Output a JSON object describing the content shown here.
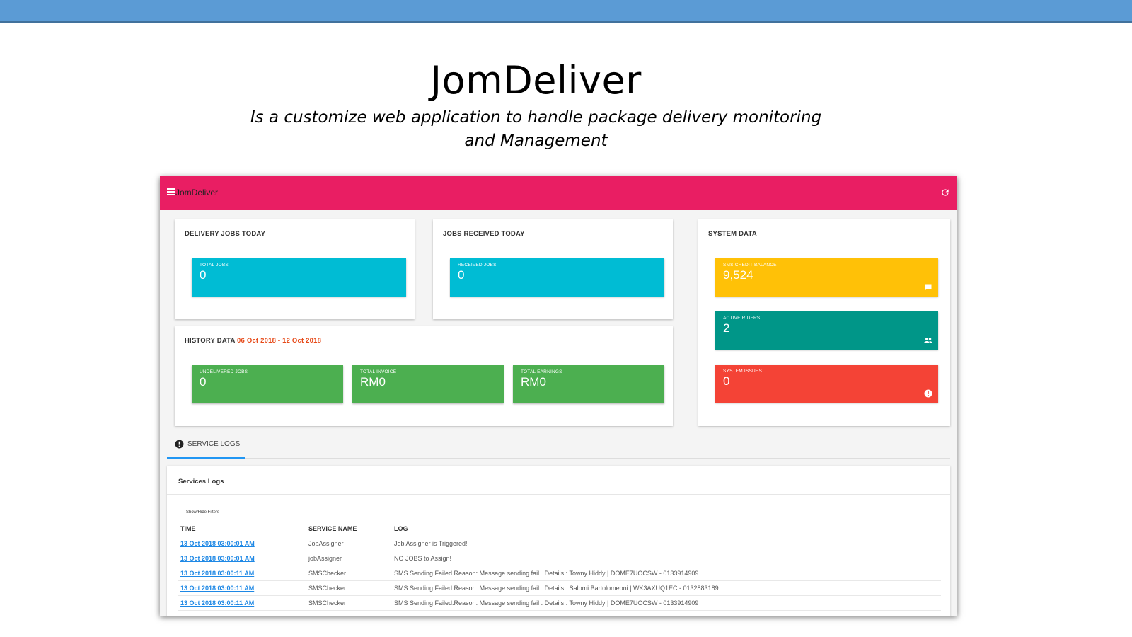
{
  "slide": {
    "title": "JomDeliver",
    "subtitle": "Is a customize web application to handle package delivery monitoring and Management"
  },
  "app": {
    "name": "JomDeliver",
    "icons": {
      "menu": "hamburger-menu-icon",
      "refresh": "refresh-icon"
    }
  },
  "delivery": {
    "heading": "DELIVERY JOBS TODAY",
    "tile_label": "TOTAL JOBS",
    "tile_value": "0"
  },
  "received": {
    "heading": "JOBS RECEIVED TODAY",
    "tile_label": "RECEIVED JOBS",
    "tile_value": "0"
  },
  "history": {
    "heading": "HISTORY DATA",
    "range": "06 Oct 2018 - 12 Oct 2018",
    "tiles": [
      {
        "label": "UNDELIVERED JOBS",
        "value": "0"
      },
      {
        "label": "TOTAL INVOICE",
        "value": "RM0"
      },
      {
        "label": "TOTAL EARNINGS",
        "value": "RM0"
      }
    ]
  },
  "system": {
    "heading": "SYSTEM DATA",
    "tiles": [
      {
        "label": "SMS CREDIT BALANCE",
        "value": "9,524",
        "icon": "chat-icon",
        "color": "#ffc107"
      },
      {
        "label": "ACTIVE RIDERS",
        "value": "2",
        "icon": "people-icon",
        "color": "#009688"
      },
      {
        "label": "SYSTEM ISSUES",
        "value": "0",
        "icon": "alert-icon",
        "color": "#f44336"
      }
    ]
  },
  "tab": {
    "label": "SERVICE LOGS",
    "icon": "alert-circle-icon"
  },
  "logs": {
    "heading": "Services Logs",
    "filters_label": "Show/Hide Filters",
    "columns": [
      "TIME",
      "SERVICE NAME",
      "LOG"
    ],
    "rows": [
      {
        "time": "13 Oct 2018 03:00:01 AM",
        "service": "JobAssigner",
        "log": "Job Assigner is Triggered!"
      },
      {
        "time": "13 Oct 2018 03:00:01 AM",
        "service": "jobAssigner",
        "log": "NO JOBS to Assign!"
      },
      {
        "time": "13 Oct 2018 03:00:11 AM",
        "service": "SMSChecker",
        "log": "SMS Sending Failed.Reason: Message sending fail . Details : Towny Hiddy | DOME7UOCSW - 0133914909"
      },
      {
        "time": "13 Oct 2018 03:00:11 AM",
        "service": "SMSChecker",
        "log": "SMS Sending Failed.Reason: Message sending fail . Details : Salomi Bartolomeoni | WK3AXUQ1EC - 0132883189"
      },
      {
        "time": "13 Oct 2018 03:00:11 AM",
        "service": "SMSChecker",
        "log": "SMS Sending Failed.Reason: Message sending fail . Details : Towny Hiddy | DOME7UOCSW - 0133914909"
      }
    ]
  },
  "colors": {
    "slide_bar": "#5b9bd5",
    "app_bar": "#e91e63",
    "cyan": "#00bcd4",
    "green": "#4caf50",
    "history_range": "#e64a19",
    "link": "#1e88e5"
  }
}
